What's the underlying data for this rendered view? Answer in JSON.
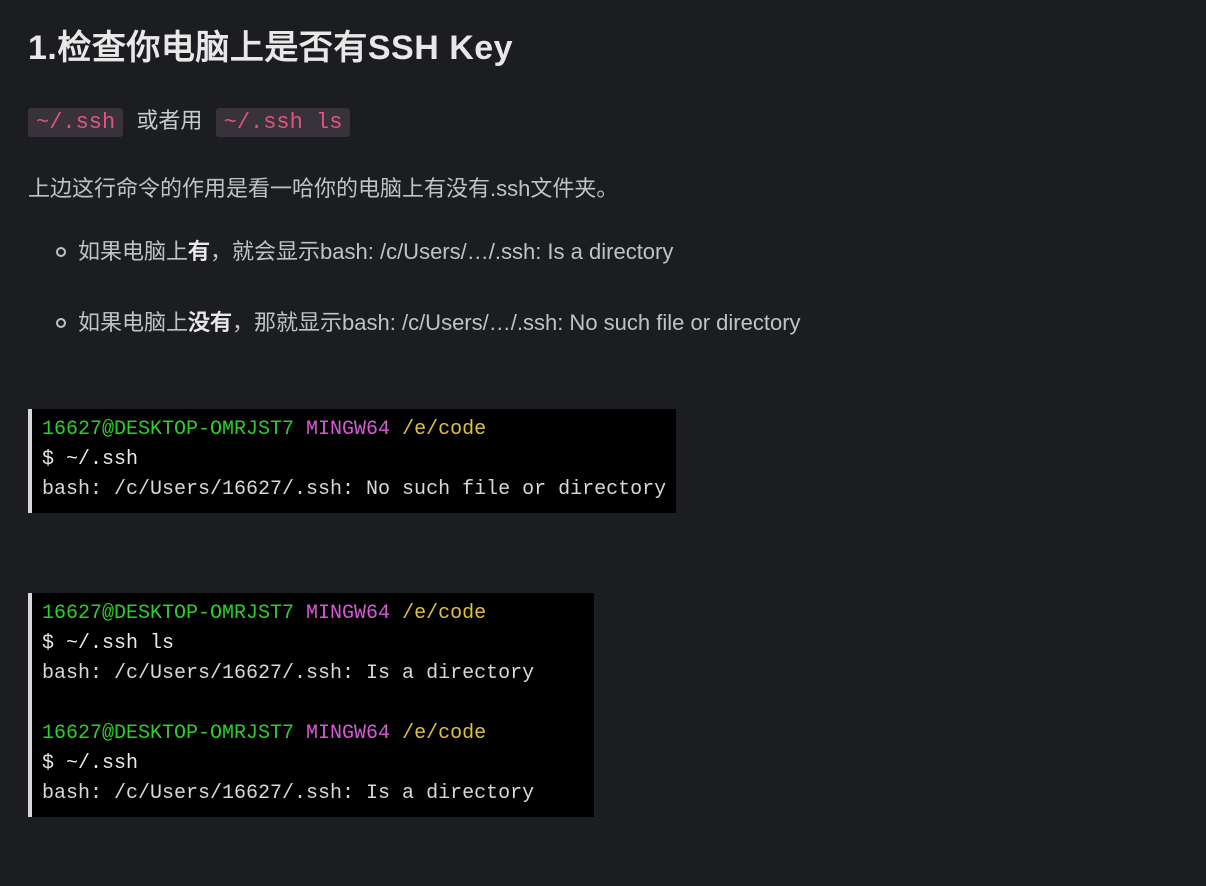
{
  "heading": "1.检查你电脑上是否有SSH Key",
  "codeline": {
    "code1": "~/.ssh",
    "sep": " 或者用 ",
    "code2": "~/.ssh ls"
  },
  "para1": "上边这行命令的作用是看一哈你的电脑上有没有.ssh文件夹。",
  "bullets": [
    {
      "pre": "如果电脑上",
      "bold": "有",
      "post": "，就会显示bash: /c/Users/…/.ssh: Is a directory"
    },
    {
      "pre": "如果电脑上",
      "bold": "没有",
      "post": "，那就显示bash: /c/Users/…/.ssh: No such file or directory"
    }
  ],
  "term1": {
    "l1_user": "16627@DESKTOP-OMRJST7 ",
    "l1_sys": "MINGW64 ",
    "l1_path": "/e/code",
    "l2": "$ ~/.ssh",
    "l3": "bash: /c/Users/16627/.ssh: No such file or directory"
  },
  "term2": {
    "b1_l1_user": "16627@DESKTOP-OMRJST7 ",
    "b1_l1_sys": "MINGW64 ",
    "b1_l1_path": "/e/code",
    "b1_l2": "$ ~/.ssh ls",
    "b1_l3": "bash: /c/Users/16627/.ssh: Is a directory",
    "b2_l1_user": "16627@DESKTOP-OMRJST7 ",
    "b2_l1_sys": "MINGW64 ",
    "b2_l1_path": "/e/code",
    "b2_l2": "$ ~/.ssh",
    "b2_l3": "bash: /c/Users/16627/.ssh: Is a directory"
  }
}
